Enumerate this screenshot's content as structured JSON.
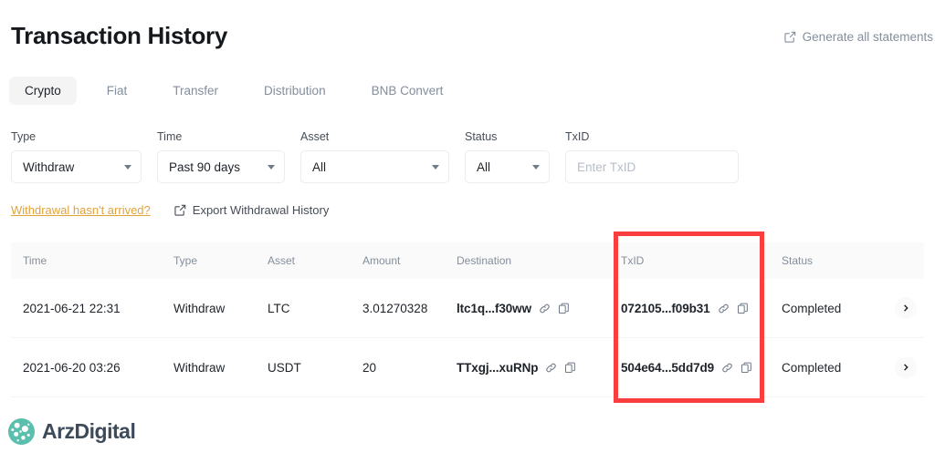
{
  "header": {
    "title": "Transaction History",
    "generate_statements": "Generate all statements",
    "generate_icon": "external-link-icon"
  },
  "tabs": [
    {
      "label": "Crypto",
      "active": true
    },
    {
      "label": "Fiat",
      "active": false
    },
    {
      "label": "Transfer",
      "active": false
    },
    {
      "label": "Distribution",
      "active": false
    },
    {
      "label": "BNB Convert",
      "active": false
    }
  ],
  "filters": {
    "type": {
      "label": "Type",
      "value": "Withdraw"
    },
    "time": {
      "label": "Time",
      "value": "Past 90 days"
    },
    "asset": {
      "label": "Asset",
      "value": "All"
    },
    "status": {
      "label": "Status",
      "value": "All"
    },
    "txid": {
      "label": "TxID",
      "value": "",
      "placeholder": "Enter TxID"
    }
  },
  "action_links": {
    "withdrawal_not_arrived": "Withdrawal hasn't arrived?",
    "export_history": "Export Withdrawal History",
    "export_icon": "external-link-icon"
  },
  "table": {
    "columns": [
      "Time",
      "Type",
      "Asset",
      "Amount",
      "Destination",
      "TxID",
      "Status"
    ],
    "rows": [
      {
        "time": "2021-06-21 22:31",
        "type": "Withdraw",
        "asset": "LTC",
        "amount": "3.01270328",
        "destination": "ltc1q...f30ww",
        "txid": "072105...f09b31",
        "status": "Completed"
      },
      {
        "time": "2021-06-20 03:26",
        "type": "Withdraw",
        "asset": "USDT",
        "amount": "20",
        "destination": "TTxgj...xuRNp",
        "txid": "504e64...5dd7d9",
        "status": "Completed"
      }
    ],
    "row_icons": {
      "link": "link-icon",
      "copy": "copy-icon",
      "expand": "chevron-right-icon"
    }
  },
  "highlight": {
    "name": "txid-column-highlight",
    "color": "#fa3e3e"
  },
  "footer": {
    "brand": "ArzDigital",
    "logo_icon": "arzdigital-logo-icon"
  },
  "colors": {
    "accent_warning": "#e2a33c",
    "muted_text": "#848e9c",
    "header_bg": "#fafafa",
    "highlight": "#fa3e3e"
  }
}
